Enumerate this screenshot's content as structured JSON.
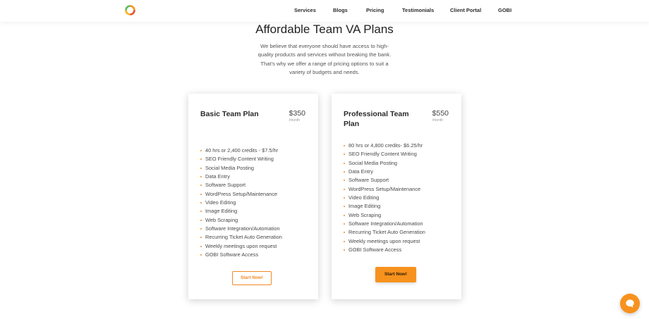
{
  "nav": {
    "items": [
      "Services",
      "Blogs",
      "Pricing",
      "Testimonials",
      "Client Portal",
      "GOBI"
    ]
  },
  "hero": {
    "title": "Affordable Team VA Plans",
    "subtitle": "We believe that everyone should have access to high-quality products and services without breaking the bank. That's why we offer a range of pricing options to suit a variety of budgets and needs."
  },
  "plans": [
    {
      "name": "Basic Team Plan",
      "price": "$350",
      "period": "/month",
      "features": [
        "40 hrs or 2,400 credits - $7.5/hr",
        "SEO Friendly Content Writing",
        "Social Media Posting",
        "Data Entry",
        "Software Support",
        "WordPress Setup/Maintenance",
        "Video Editing",
        "Image Editing",
        "Web Scraping",
        "Software Integration/Automation",
        "Recurring Ticket Auto Generation",
        "Weekly meetings upon request",
        "GOBI Software Access"
      ],
      "button": "Start Now!"
    },
    {
      "name": "Professional Team Plan",
      "price": "$550",
      "period": "/month",
      "features": [
        "80 hrs or 4,800 credits- $6.25/hr",
        "SEO Friendly Content Writing",
        "Social Media Posting",
        "Data Entry",
        "Software Support",
        "WordPress Setup/Maintenance",
        "Video Editing",
        "Image Editing",
        "Web Scraping",
        "Software Integration/Automation",
        "Recurring Ticket Auto Generation",
        "Weekly meetings upon request",
        "GOBI Software Access"
      ],
      "button": "Start Now!"
    }
  ],
  "icons": {
    "logo": "brand-logo-icon",
    "chat": "chat-bubble-icon",
    "bullet": "bullet-dot-icon"
  },
  "colors": {
    "accent": "#f7921e",
    "text": "#3a3a3a",
    "background": "#ffffff"
  }
}
